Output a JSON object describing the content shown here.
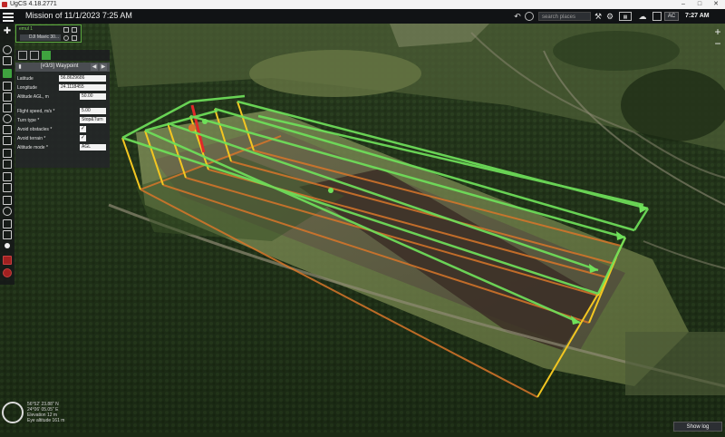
{
  "window": {
    "title": "UgCS 4.18.2771",
    "minimize": "–",
    "maximize": "□",
    "close": "✕"
  },
  "topbar": {
    "mission_title": "Mission of 11/1/2023 7:25 AM",
    "search_placeholder": "search places",
    "ac_label": "AC",
    "clock": "7:27 AM",
    "icons": [
      "menu-icon",
      "undo-icon",
      "camera-icon",
      "tools-icon",
      "keyboard-icon",
      "weather-icon",
      "battery-icon",
      "user-icon",
      "settings-icon"
    ]
  },
  "vehicle_card": {
    "name": "emul 1",
    "model": "DJI Mavic 30..."
  },
  "waypoint_panel": {
    "title": "[#3/3] Waypoint",
    "prev": "◀",
    "next": "▶",
    "fields": [
      {
        "label": "Latitude",
        "value": "56.8629686"
      },
      {
        "label": "Longitude",
        "value": "24.1118455"
      },
      {
        "label": "Altitude AGL, m",
        "value": "50.00"
      },
      {
        "label": "Flight speed, m/s *",
        "value": "5.00"
      },
      {
        "label": "Turn type *",
        "value": "Stop&Turn"
      },
      {
        "label": "Avoid obstacles *",
        "value": "✓"
      },
      {
        "label": "Avoid terrain *",
        "value": "✓"
      },
      {
        "label": "Altitude mode *",
        "value": "AGL"
      }
    ]
  },
  "map": {
    "status": {
      "lat": "56°52′ 23.88″ N",
      "lon": "24°06′ 05.05″ E",
      "elevation": "Elevation 12 m",
      "eye_altitude": "Eye altitude 161 m"
    },
    "colors": {
      "route": "#6fe05a",
      "ground": "#d8762a",
      "poles": "#f3c621",
      "pole_active": "#e02a2a"
    }
  },
  "show_log": "Show log",
  "zoom": {
    "in": "+",
    "out": "−"
  }
}
